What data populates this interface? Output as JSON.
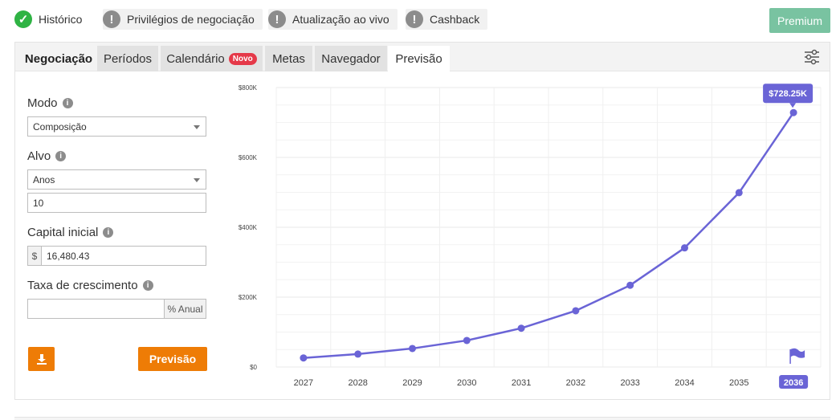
{
  "status_items": [
    {
      "label": "Histórico",
      "icon": "check-circle-icon",
      "state": "ok"
    },
    {
      "label": "Privilégios de negociação",
      "icon": "exclamation-circle-icon",
      "state": "warn"
    },
    {
      "label": "Atualização ao vivo",
      "icon": "exclamation-circle-icon",
      "state": "warn"
    },
    {
      "label": "Cashback",
      "icon": "exclamation-circle-icon",
      "state": "warn"
    }
  ],
  "premium_label": "Premium",
  "tabs": {
    "negociacao": "Negociação",
    "periodos": "Períodos",
    "calendario": "Calendário",
    "calendario_badge": "Novo",
    "metas": "Metas",
    "navegador": "Navegador",
    "previsao": "Previsão",
    "active": "Previsão"
  },
  "form": {
    "modo_label": "Modo",
    "modo_value": "Composição",
    "alvo_label": "Alvo",
    "alvo_value": "Anos",
    "alvo_years": "10",
    "capital_label": "Capital inicial",
    "capital_prefix": "$",
    "capital_value": "16,480.43",
    "taxa_label": "Taxa de crescimento",
    "taxa_value": "",
    "taxa_suffix": "% Anual",
    "forecast_button": "Previsão"
  },
  "colors": {
    "accent": "#ee7c06",
    "premium": "#79c3a1",
    "line": "#6a64d6",
    "ok": "#2fb344",
    "warn": "#8c8c8c",
    "badge": "#e53949"
  },
  "chart_data": {
    "type": "line",
    "x": [
      "2027",
      "2028",
      "2029",
      "2030",
      "2031",
      "2032",
      "2033",
      "2034",
      "2035",
      "2036"
    ],
    "values": [
      26000,
      37000,
      53000,
      76000,
      111000,
      161000,
      234000,
      341000,
      499000,
      728250
    ],
    "ylim": [
      0,
      800000
    ],
    "yticks": [
      0,
      200000,
      400000,
      600000,
      800000
    ],
    "ytick_labels": [
      "$0",
      "$200K",
      "$400K",
      "$600K",
      "$800K"
    ],
    "last_value_label": "$728.25K",
    "highlighted_x": "2036",
    "grid": true
  }
}
